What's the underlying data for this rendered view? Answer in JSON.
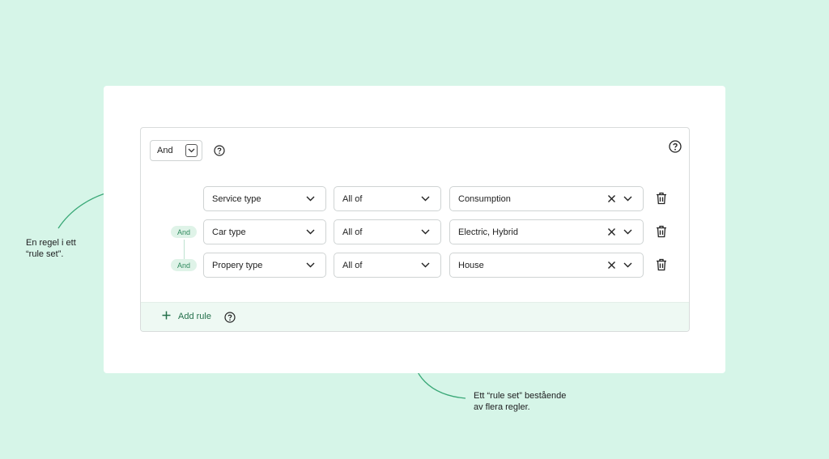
{
  "ruleset": {
    "combinator": "And",
    "rules": [
      {
        "connector": "",
        "field": "Service type",
        "operator": "All of",
        "value": "Consumption"
      },
      {
        "connector": "And",
        "field": "Car type",
        "operator": "All of",
        "value": "Electric, Hybrid"
      },
      {
        "connector": "And",
        "field": "Propery type",
        "operator": "All of",
        "value": "House"
      }
    ],
    "add_rule_label": "Add rule"
  },
  "annotations": {
    "rule_line1": "En regel i ett",
    "rule_line2": "“rule set”.",
    "ruleset_line1": "Ett “rule set” bestående",
    "ruleset_line2": "av flera regler."
  },
  "colors": {
    "background": "#d6f5e8",
    "accent": "#2f8a5e",
    "arrow": "#3aa877"
  }
}
